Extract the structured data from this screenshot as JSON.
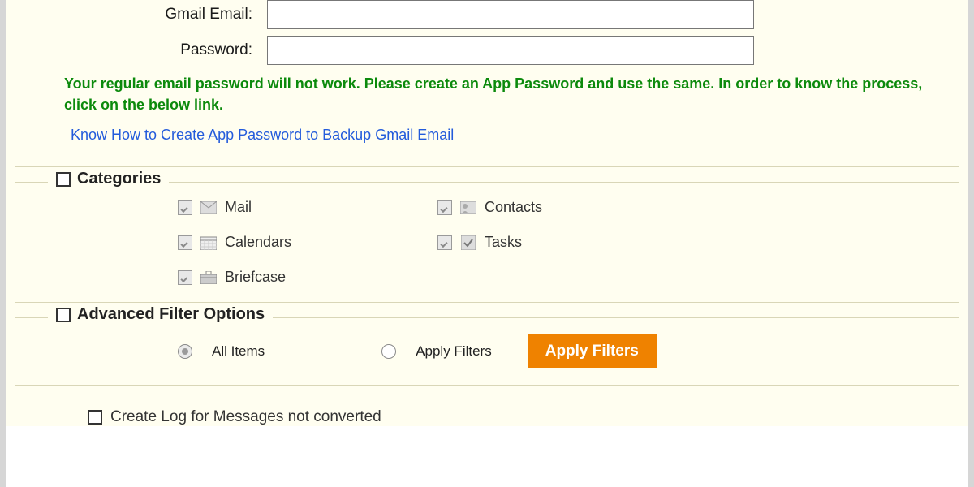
{
  "credentials": {
    "email_label": "Gmail Email:",
    "password_label": "Password:",
    "hint": "Your regular email password will not work. Please create an App Password and use the same. In order to know the process, click on the below link.",
    "link_text": "Know How to Create App Password to Backup Gmail Email"
  },
  "categories": {
    "title": "Categories",
    "items": [
      {
        "label": "Mail"
      },
      {
        "label": "Contacts"
      },
      {
        "label": "Calendars"
      },
      {
        "label": "Tasks"
      },
      {
        "label": "Briefcase"
      }
    ]
  },
  "advanced": {
    "title": "Advanced Filter Options",
    "all_items_label": "All Items",
    "apply_filters_label": "Apply Filters",
    "apply_button_label": "Apply Filters"
  },
  "log": {
    "label": "Create Log for Messages not converted"
  }
}
